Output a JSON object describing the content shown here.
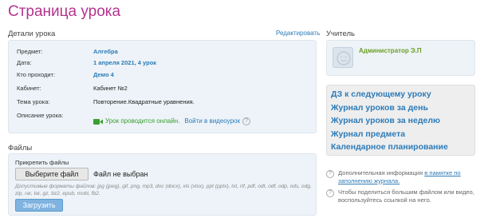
{
  "page_title": "Страница урока",
  "details": {
    "section_title": "Детали урока",
    "edit_label": "Редактировать",
    "rows": [
      {
        "label": "Предмет:",
        "value": "Алгебра"
      },
      {
        "label": "Дата:",
        "value": "1 апреля 2021, 4 урок"
      },
      {
        "label": "Кто проходит:",
        "value": "Демо 4"
      },
      {
        "label": "Кабинет:",
        "value": "Кабинет №2"
      },
      {
        "label": "Тема урока:",
        "value": "Повторение.Квадратные уравнения."
      },
      {
        "label": "Описание урока:",
        "value": ""
      }
    ],
    "online_text": "Урок проводится онлайн.",
    "video_link": "Войти в видеоурок",
    "help_icon": "?"
  },
  "files": {
    "section_title": "Файлы",
    "attach_label": "Прикрепить файлы",
    "choose_button": "Выберите файл",
    "no_file_text": "Файл не выбран",
    "formats_text": "Допустимые форматы файлов: jpg (jpeg), gif, png, mp3, doc (docx), xls (xlsx), ppt (pptx), txt, rtf, pdf, odt, odf, odp, ods, odg, zip, rar, tar, gz, bz2, epub, mobi, fb2.",
    "upload_button": "Загрузить"
  },
  "teacher": {
    "section_title": "Учитель",
    "name": "Администратор Э.П"
  },
  "quick_links": [
    "ДЗ к следующему уроку",
    "Журнал уроков за день",
    "Журнал уроков за неделю",
    "Журнал предмета",
    "Календарное планирование"
  ],
  "info1": {
    "text": "Дополнительная информация ",
    "link": "в памятке по заполнению журнала."
  },
  "info2": {
    "text": "Чтобы поделиться большим файлом или видео, воспользуйтесь ссылкой на него."
  },
  "colors": {
    "title": "#b5338d",
    "link": "#2d7bb8",
    "online": "#3b9e2f",
    "teacher_name": "#6a9f24",
    "upload_button": "#7fb3e0"
  }
}
